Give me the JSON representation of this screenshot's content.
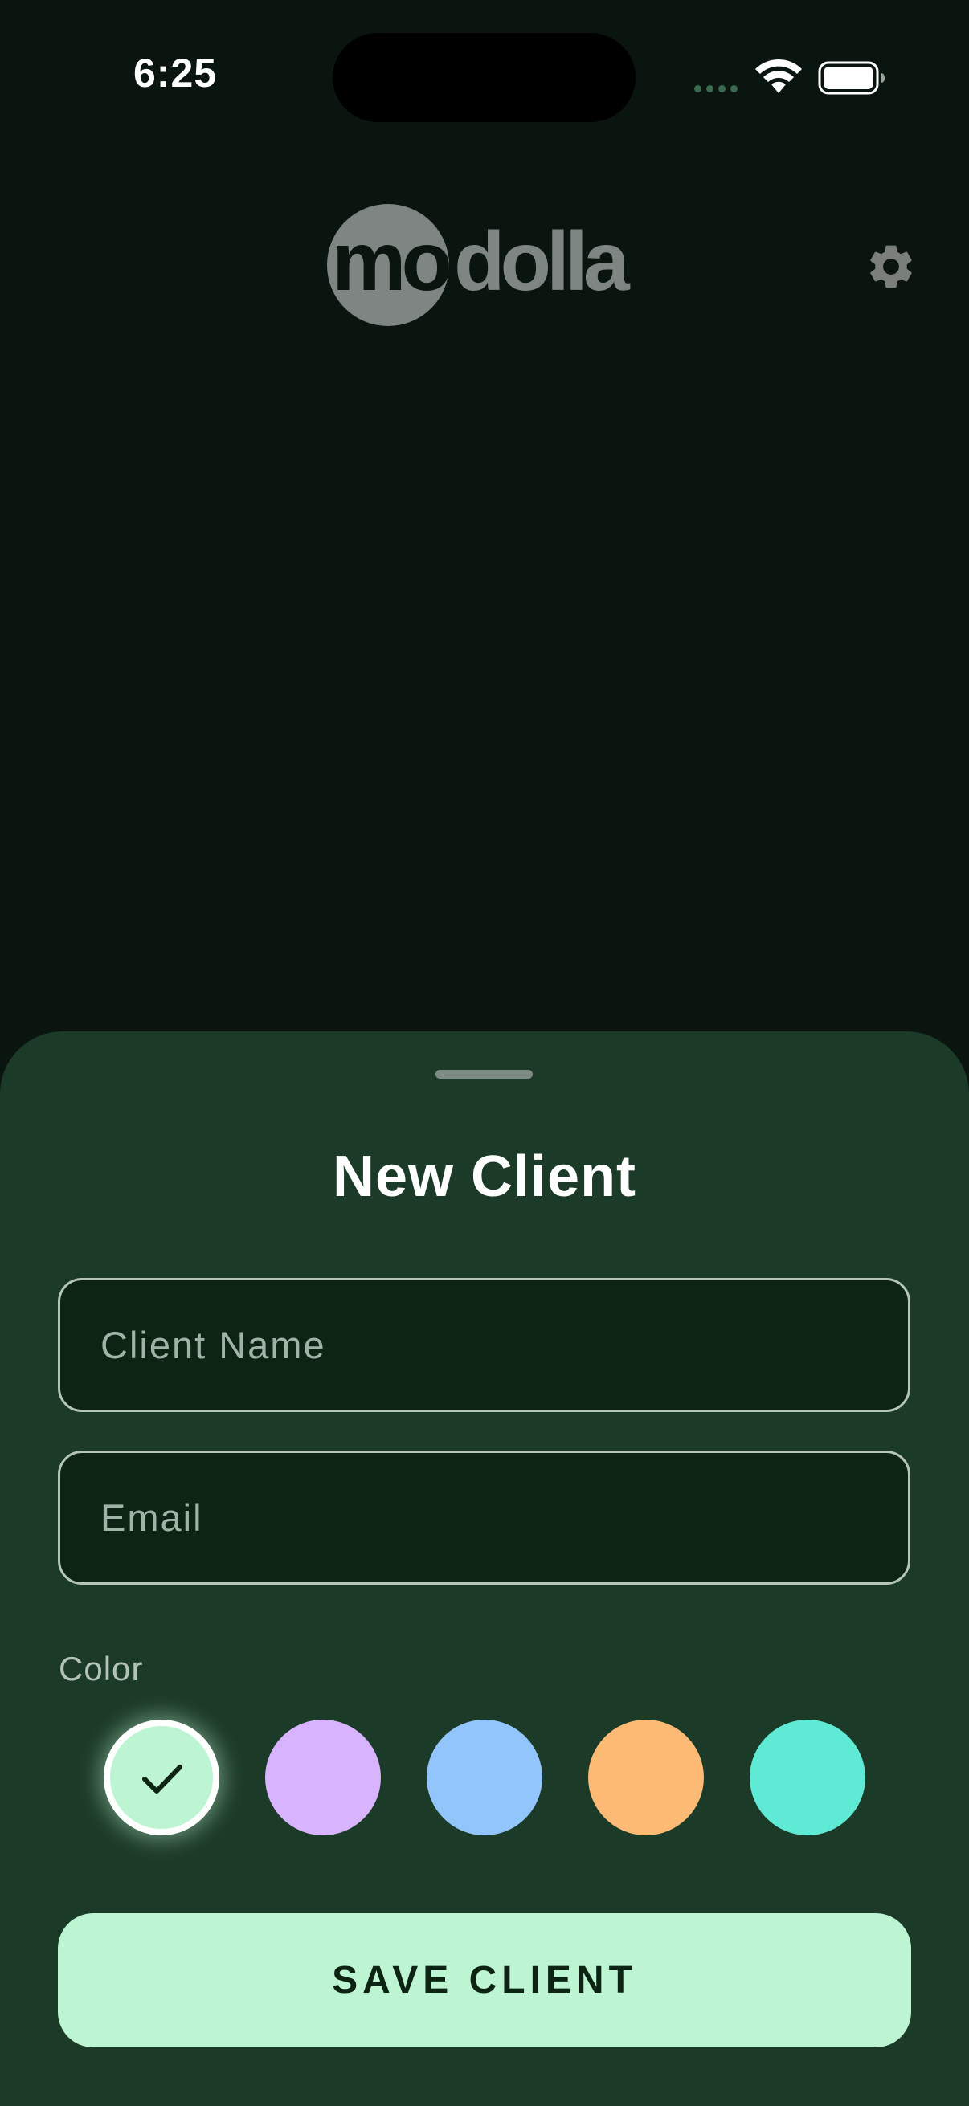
{
  "status_bar": {
    "time": "6:25",
    "icons": [
      "cellular-signal-icon",
      "wifi-icon",
      "battery-icon"
    ]
  },
  "header": {
    "logo_text": "modolla",
    "settings_icon": "gear-icon"
  },
  "sheet": {
    "title": "New Client",
    "name_field": {
      "placeholder": "Client Name",
      "value": ""
    },
    "email_field": {
      "placeholder": "Email",
      "value": ""
    },
    "color_label": "Color",
    "colors": [
      {
        "hex": "#bdf5d2",
        "selected": true
      },
      {
        "hex": "#d8b4fe",
        "selected": false
      },
      {
        "hex": "#93c5fd",
        "selected": false
      },
      {
        "hex": "#fdba74",
        "selected": false
      },
      {
        "hex": "#5eead4",
        "selected": false
      }
    ],
    "save_label": "SAVE CLIENT"
  },
  "theme": {
    "background": "#0a1510",
    "sheet_background": "#1b3a27",
    "accent": "#bdf5d2",
    "logo_color": "#7f8582"
  }
}
